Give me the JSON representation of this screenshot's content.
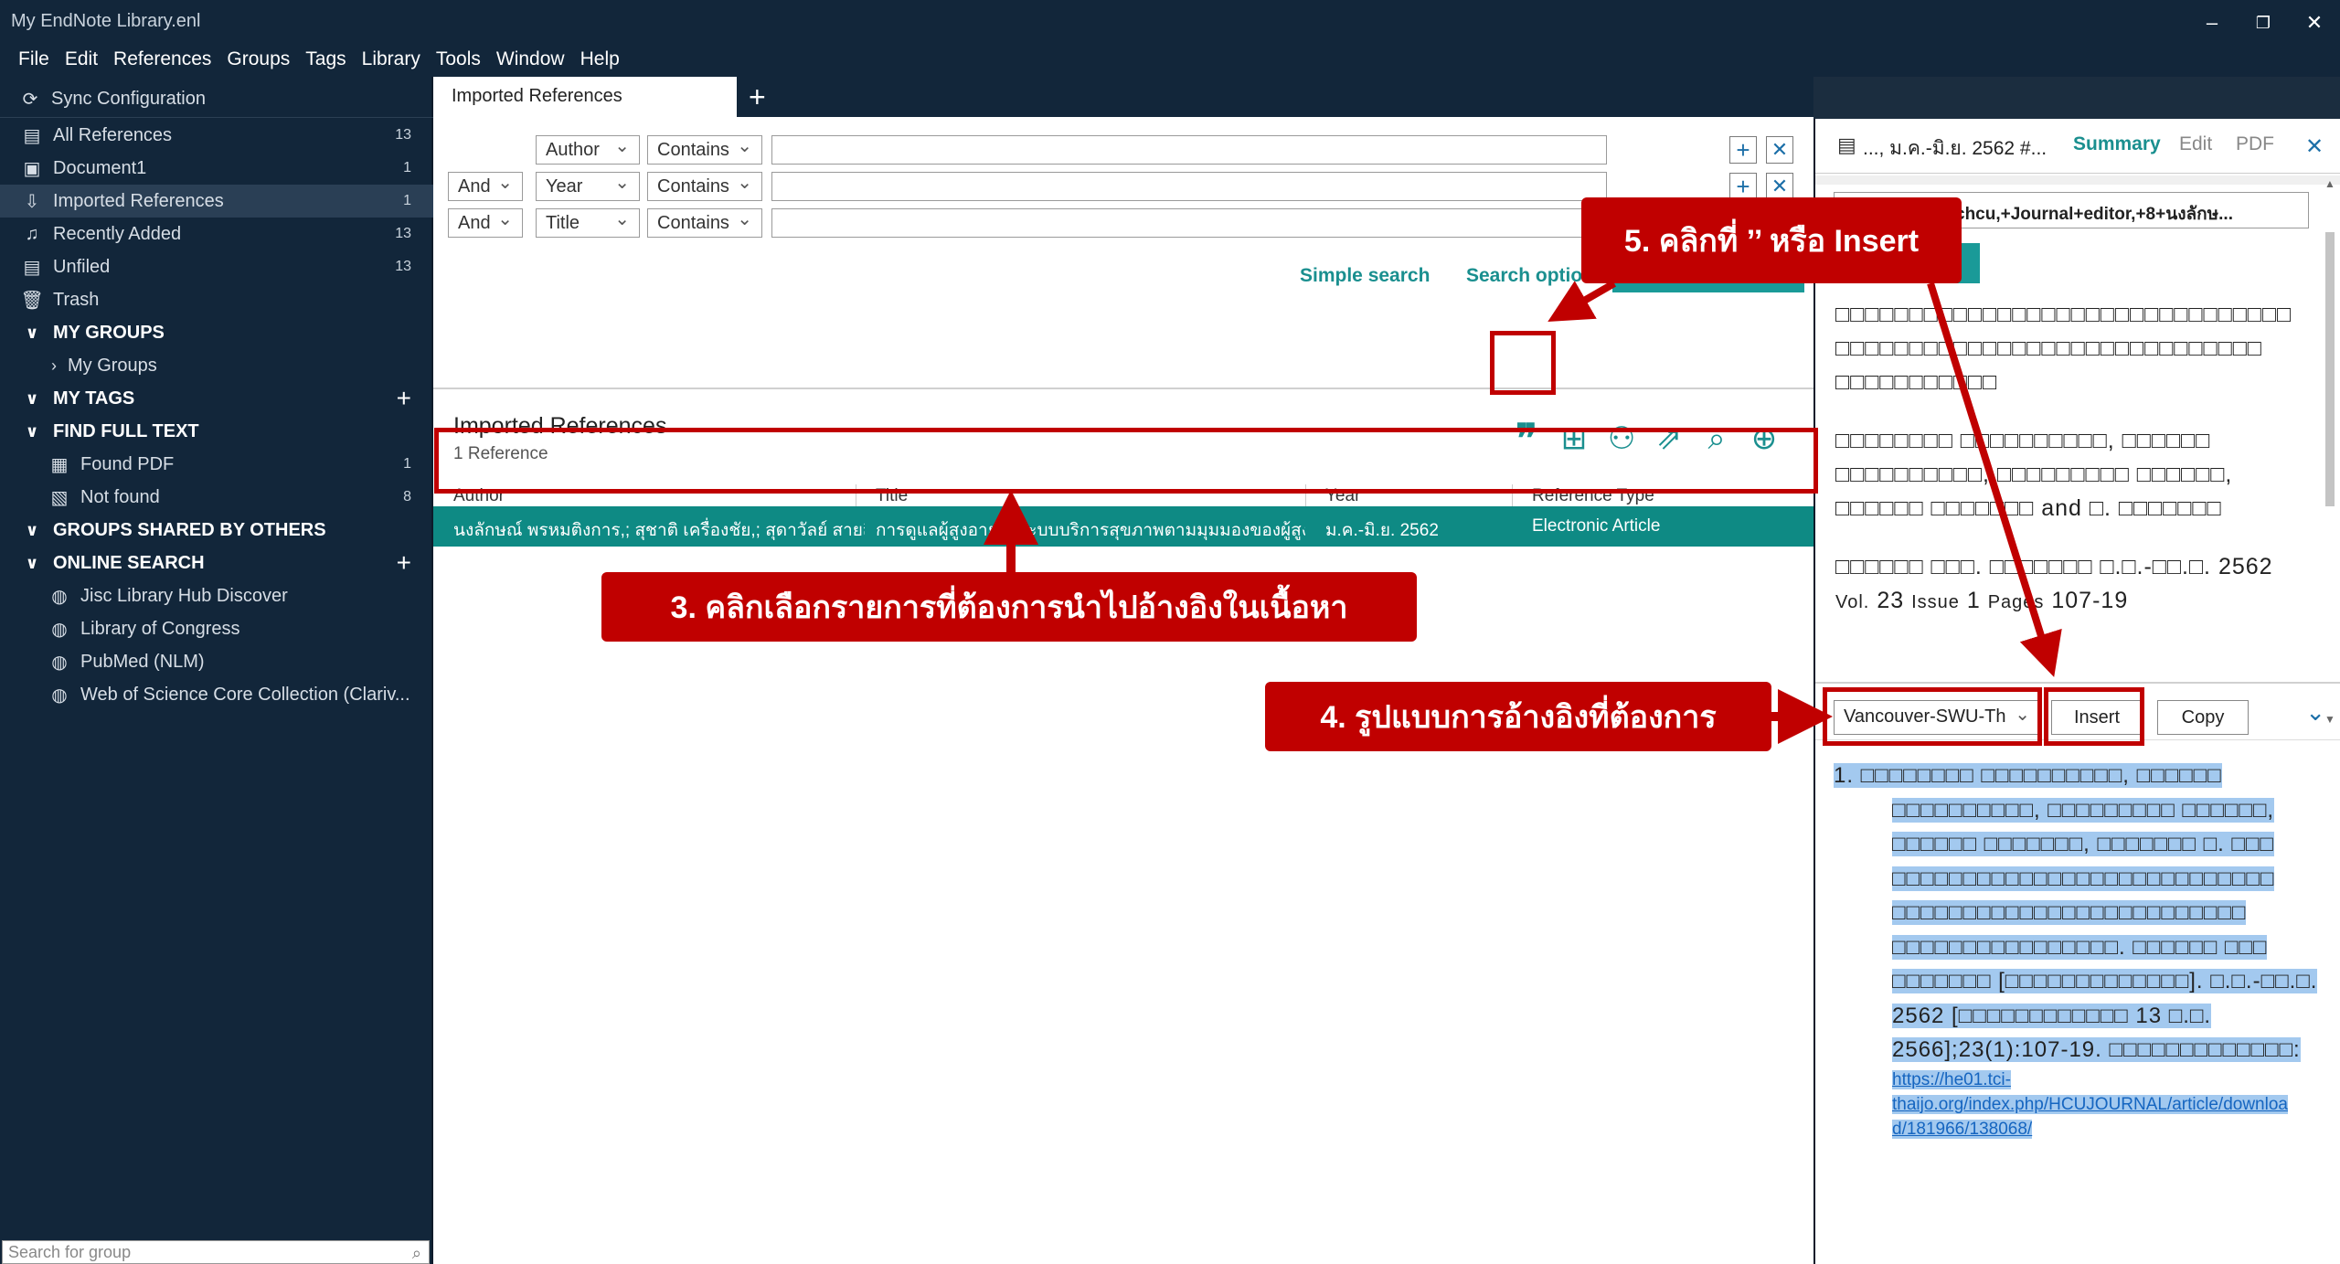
{
  "window": {
    "title": "My EndNote Library.enl",
    "minimize": "–",
    "restore": "❐",
    "close": "✕"
  },
  "menu": [
    "File",
    "Edit",
    "References",
    "Groups",
    "Tags",
    "Library",
    "Tools",
    "Window",
    "Help"
  ],
  "sidebar": {
    "sync": "Sync Configuration",
    "items": [
      {
        "label": "All References",
        "count": "13"
      },
      {
        "label": "Document1",
        "count": "1"
      },
      {
        "label": "Imported References",
        "count": "1"
      },
      {
        "label": "Recently Added",
        "count": "13"
      },
      {
        "label": "Unfiled",
        "count": "13"
      },
      {
        "label": "Trash",
        "count": ""
      }
    ],
    "my_groups": "MY GROUPS",
    "my_groups_sub": "My Groups",
    "my_tags": "MY TAGS",
    "find_full_text": "FIND FULL TEXT",
    "fft_items": [
      {
        "label": "Found PDF",
        "count": "1"
      },
      {
        "label": "Not found",
        "count": "8"
      }
    ],
    "groups_shared": "GROUPS SHARED BY OTHERS",
    "online_search": "ONLINE SEARCH",
    "online_items": [
      "Jisc Library Hub Discover",
      "Library of Congress",
      "PubMed (NLM)",
      "Web of Science Core Collection (Clariv..."
    ],
    "search_placeholder": "Search for group"
  },
  "tabs": {
    "active": "Imported References",
    "add": "+"
  },
  "search": {
    "rows": [
      {
        "logic": "",
        "field": "Author",
        "op": "Contains"
      },
      {
        "logic": "And",
        "field": "Year",
        "op": "Contains"
      },
      {
        "logic": "And",
        "field": "Title",
        "op": "Contains"
      }
    ],
    "simple_search": "Simple search",
    "search_options": "Search optio",
    "search_button": ""
  },
  "reflist": {
    "title": "Imported References",
    "count": "1 Reference",
    "columns": [
      "Author",
      "Title",
      "Year",
      "Reference Type"
    ],
    "rows": [
      {
        "author": "นงลักษณ์ พรหมติงการ,; สุชาติ เครื่องชัย,; สุดาวัลย์ สายสื...",
        "title": "การดูแลผู้สูงอายุในระบบบริการสุขภาพตามมุมมองของผู้สูงอา...",
        "year": "ม.ค.-มิ.ย. 2562",
        "type": "Electronic Article"
      }
    ]
  },
  "right": {
    "header": "..., ม.ค.-มิ.ย. 2562 #...",
    "tabs": [
      "Summary",
      "Edit",
      "PDF"
    ],
    "dropdown": "chcu,+Journal+editor,+8+นงลักษ...",
    "green_btn": "e",
    "summary_lines": [
      "□□□□□□□□□□□□□□□□□□□□□□□□□□□□□□□",
      "□□□□□□□□□□□□□□□□□□□□□□□□□□□□□",
      "□□□□□□□□□□□",
      "□□□□□□□□ □□□□□□□□□□, □□□□□□",
      "□□□□□□□□□□, □□□□□□□□□ □□□□□□,",
      "□□□□□□ □□□□□□□ and □. □□□□□□□",
      "□□□□□□ □□□. □□□□□□□ □.□.-□□.□. 2562"
    ],
    "vol_line": {
      "vol_label": "Vol.",
      "vol": "23",
      "issue_label": "Issue",
      "issue": "1",
      "pages_label": "Pages",
      "pages": "107-19"
    },
    "citation_style": "Vancouver-SWU-Th",
    "insert": "Insert",
    "copy": "Copy",
    "preview": {
      "lines": [
        "1. □□□□□□□□ □□□□□□□□□□, □□□□□□",
        "□□□□□□□□□□, □□□□□□□□□ □□□□□□,",
        "□□□□□□ □□□□□□□, □□□□□□□ □. □□□",
        "□□□□□□□□□□□□□□□□□□□□□□□□□□□",
        "□□□□□□□□□□□□□□□□□□□□□□□□□",
        "□□□□□□□□□□□□□□□□. □□□□□□ □□□",
        "□□□□□□□ [□□□□□□□□□□□□□]. □.□.-□□.□.",
        "2562 [□□□□□□□□□□□□ 13 □.□.",
        "2566];23(1):107-19. □□□□□□□□□□□□□:"
      ],
      "url_lines": [
        "https://he01.tci-",
        "thaijo.org/index.php/HCUJOURNAL/article/downloa",
        "d/181966/138068/"
      ]
    }
  },
  "annotations": {
    "step3": "3. คลิกเลือกรายการที่ต้องการนำไปอ้างอิงในเนื้อหา",
    "step4": "4. รูปแบบการอ้างอิงที่ต้องการ",
    "step5": "5. คลิกที่ ’’ หรือ Insert"
  },
  "colors": {
    "accent": "#1a9a98",
    "annotation": "#c00000",
    "sidebar": "#12263a"
  }
}
